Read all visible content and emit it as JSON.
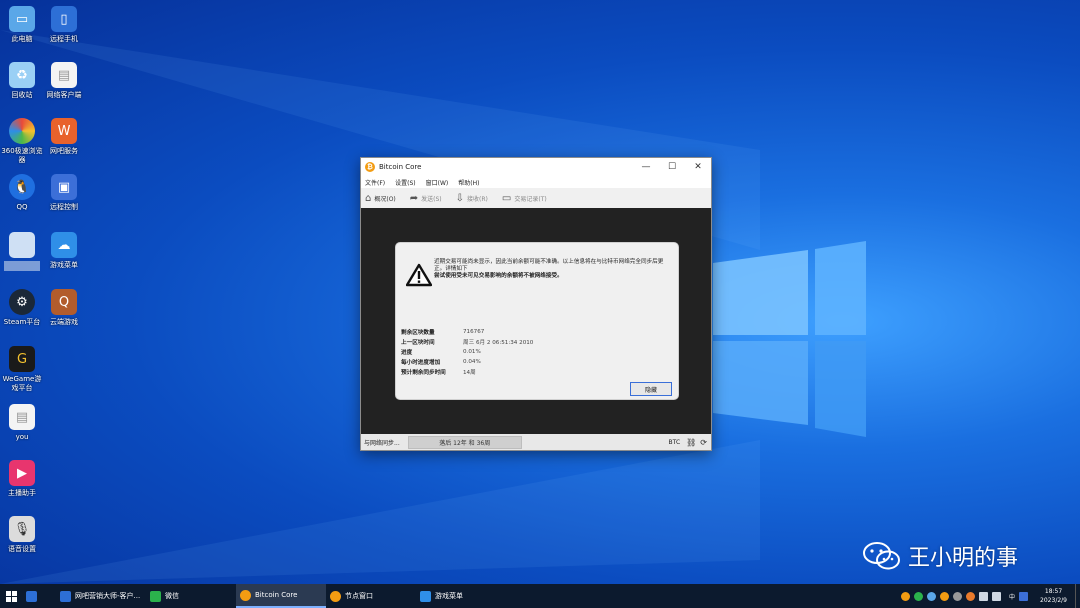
{
  "desktop_icons": [
    {
      "label": "此电脑",
      "icon": "computer-icon",
      "color": "#5aa7e8"
    },
    {
      "label": "远程手机",
      "icon": "remote-phone-icon",
      "color": "#2d6fd6"
    },
    {
      "label": "回收站",
      "icon": "recycle-bin-icon",
      "color": "#9ad0f5"
    },
    {
      "label": "网络客户端",
      "icon": "document-icon",
      "color": "#f4f4f4"
    },
    {
      "label": "360极速浏览器",
      "icon": "browser-360-icon",
      "color": "#e84a3a"
    },
    {
      "label": "网吧服务",
      "icon": "netbar-service-icon",
      "color": "#e8622c"
    },
    {
      "label": "QQ",
      "icon": "qq-icon",
      "color": "#1f6fe0"
    },
    {
      "label": "远程控制",
      "icon": "remote-control-icon",
      "color": "#3c6fd8"
    },
    {
      "label": "",
      "icon": "blurred-app-icon",
      "color": "#cfe0f4"
    },
    {
      "label": "游戏菜单",
      "icon": "game-menu-icon",
      "color": "#2f8fe8"
    },
    {
      "label": "Steam平台",
      "icon": "steam-icon",
      "color": "#1b2838"
    },
    {
      "label": "云端游戏",
      "icon": "cloud-game-icon",
      "color": "#b25c2c"
    },
    {
      "label": "WeGame游戏平台",
      "icon": "wegame-icon",
      "color": "#1a1a1a"
    },
    {
      "label": "you",
      "icon": "document-icon",
      "color": "#f4f4f4"
    },
    {
      "label": "主播助手",
      "icon": "streamer-icon",
      "color": "#e8356e"
    },
    {
      "label": "语音设置",
      "icon": "microphone-icon",
      "color": "#dcdcdc"
    }
  ],
  "window": {
    "title": "Bitcoin Core",
    "menu": [
      "文件(F)",
      "设置(S)",
      "窗口(W)",
      "帮助(H)"
    ],
    "toolbar": [
      "概况(O)",
      "发送(S)",
      "接收(R)",
      "交易记录(T)"
    ],
    "modal": {
      "message_1": "近期交易可能尚未显示，因此当前余额可能不准确。以上信息将在与比特币网络完全同步后更正。详情如下",
      "message_2": "尝试使用受未可见交易影响的余额将不被网络接受。",
      "stats": [
        {
          "key": "剩余区块数量",
          "value": "716767"
        },
        {
          "key": "上一区块时间",
          "value": "周三 6月 2 06:51:34 2010"
        },
        {
          "key": "进度",
          "value": "0.01%"
        },
        {
          "key": "每小时进度增加",
          "value": "0.04%"
        },
        {
          "key": "预计剩余同步时间",
          "value": "14周"
        }
      ],
      "hide_button": "隐藏"
    },
    "status": {
      "sync": "与网络同步...",
      "progress_text": "落后 12年 和 36周",
      "unit": "BTC"
    }
  },
  "watermark": "王小明的事",
  "taskbar": {
    "items": [
      {
        "label": "网吧营销大师-客户...",
        "color": "#2d6fd6"
      },
      {
        "label": "微信",
        "color": "#2bb24c"
      },
      {
        "label": "Bitcoin Core",
        "color": "#f39c12"
      },
      {
        "label": "节点窗口",
        "color": "#f39c12"
      },
      {
        "label": "游戏菜单",
        "color": "#2f8fe8"
      }
    ],
    "ime": "中",
    "time": "18:57",
    "date": "2023/2/9"
  }
}
